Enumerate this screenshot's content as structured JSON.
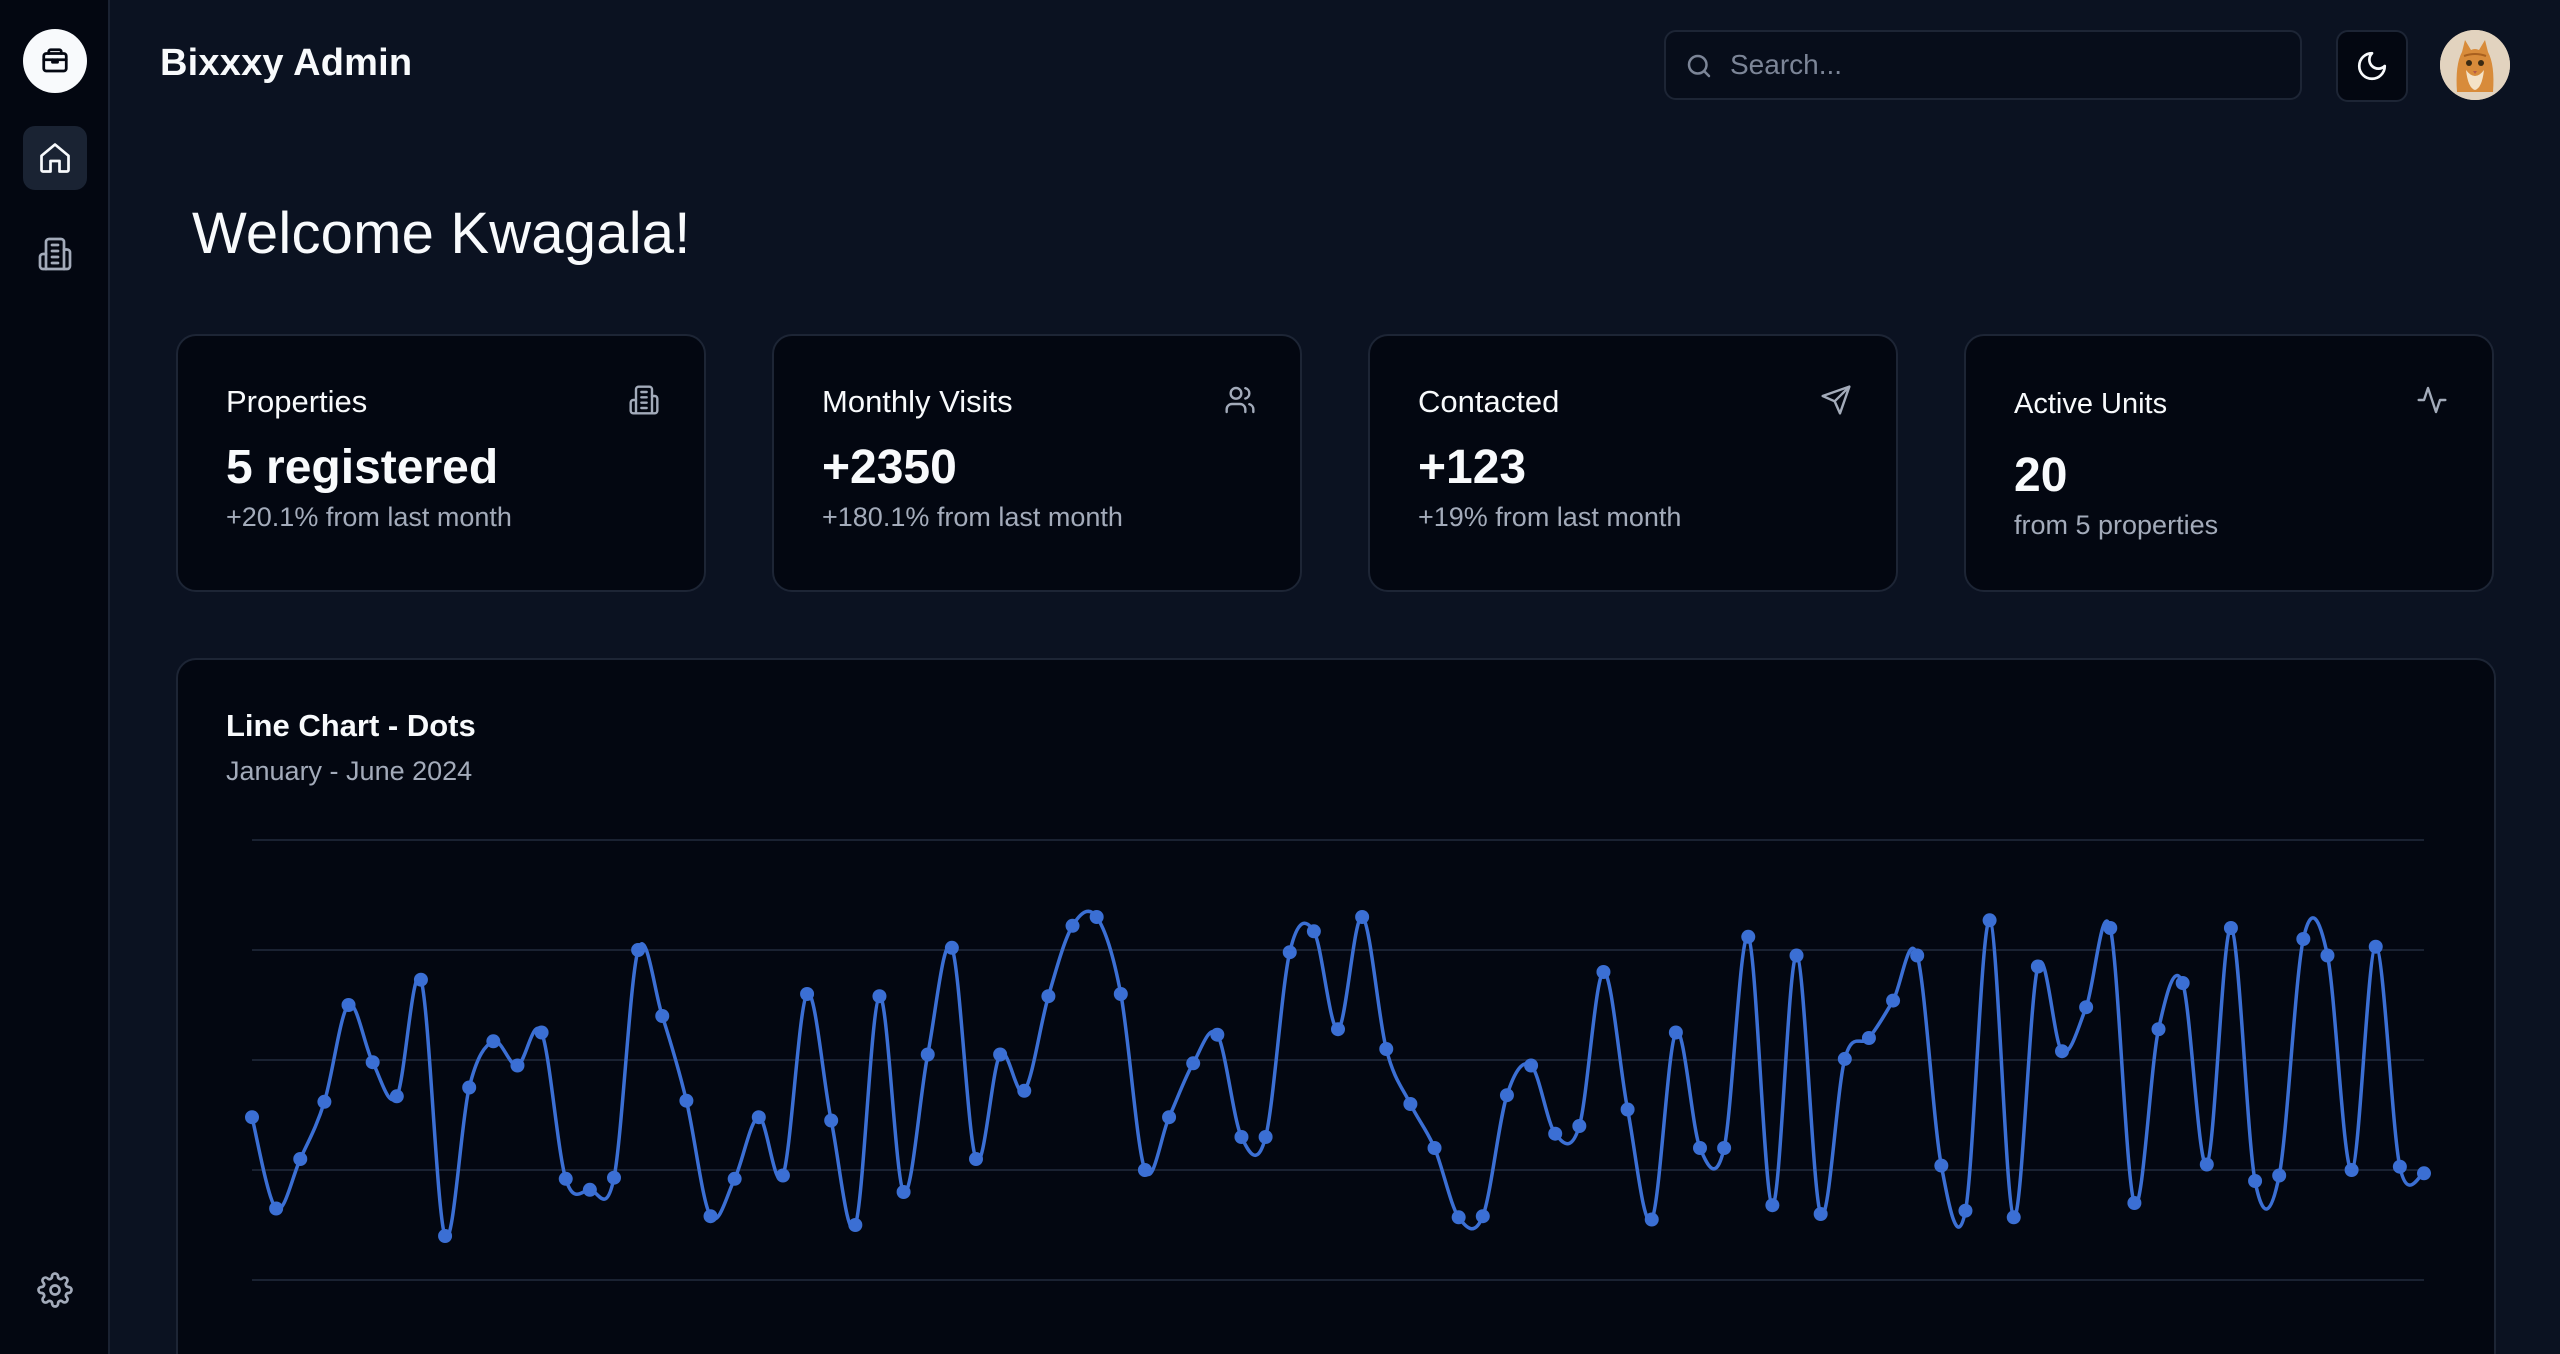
{
  "app": {
    "title": "Bixxxy Admin"
  },
  "search": {
    "placeholder": "Search..."
  },
  "welcome": "Welcome Kwagala!",
  "cards": [
    {
      "title": "Properties",
      "value": "5 registered",
      "sub": "+20.1% from last month",
      "icon": "building-icon"
    },
    {
      "title": "Monthly Visits",
      "value": "+2350",
      "sub": "+180.1% from last month",
      "icon": "users-icon"
    },
    {
      "title": "Contacted",
      "value": "+123",
      "sub": "+19% from last month",
      "icon": "send-icon"
    },
    {
      "title": "Active Units",
      "value": "20",
      "sub": "from 5 properties",
      "icon": "activity-icon"
    }
  ],
  "chart": {
    "title": "Line Chart - Dots",
    "subtitle": "January - June 2024"
  },
  "colors": {
    "line": "#3b6fd4",
    "background": "#030711",
    "page": "#0b1221"
  },
  "chart_data": {
    "type": "line",
    "title": "Line Chart - Dots",
    "subtitle": "January - June 2024",
    "ylim": [
      0,
      4
    ],
    "grid": true,
    "series": [
      {
        "values": [
          1.48,
          0.65,
          1.1,
          1.62,
          2.5,
          1.98,
          1.67,
          2.73,
          0.4,
          1.75,
          2.17,
          1.95,
          2.25,
          0.92,
          0.82,
          0.93,
          3,
          2.4,
          1.63,
          0.58,
          0.92,
          1.48,
          0.95,
          2.6,
          1.45,
          0.5,
          2.58,
          0.8,
          2.05,
          3.02,
          1.1,
          2.05,
          1.72,
          2.58,
          3.22,
          3.3,
          2.6,
          1,
          1.48,
          1.97,
          2.23,
          1.3,
          1.3,
          2.98,
          3.17,
          2.28,
          3.3,
          2.1,
          1.6,
          1.2,
          0.57,
          0.58,
          1.68,
          1.95,
          1.33,
          1.4,
          2.8,
          1.55,
          0.55,
          2.25,
          1.2,
          1.2,
          3.12,
          0.68,
          2.95,
          0.6,
          2.01,
          2.2,
          2.54,
          2.95,
          1.04,
          0.63,
          3.27,
          0.57,
          2.85,
          2.08,
          2.48,
          3.2,
          0.7,
          2.28,
          2.7,
          1.05,
          3.2,
          0.9,
          0.95,
          3.1,
          2.95,
          1,
          3.03,
          1.03,
          0.97
        ]
      }
    ]
  }
}
